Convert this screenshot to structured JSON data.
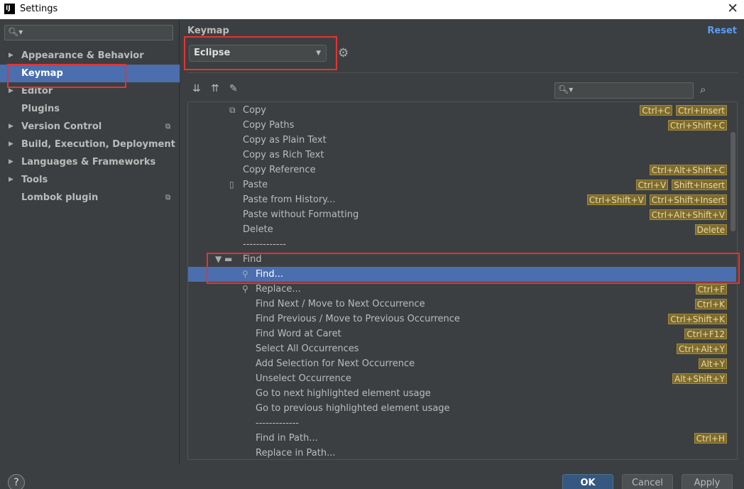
{
  "window": {
    "title": "Settings",
    "logo": "IJ",
    "close_icon": "close-icon"
  },
  "sidebar": {
    "search_placeholder": "",
    "items": [
      {
        "label": "Appearance & Behavior",
        "arrow": "▶",
        "project": ""
      },
      {
        "label": "Keymap",
        "arrow": "",
        "project": ""
      },
      {
        "label": "Editor",
        "arrow": "▶",
        "project": ""
      },
      {
        "label": "Plugins",
        "arrow": "",
        "project": ""
      },
      {
        "label": "Version Control",
        "arrow": "▶",
        "project": "⧉"
      },
      {
        "label": "Build, Execution, Deployment",
        "arrow": "▶",
        "project": ""
      },
      {
        "label": "Languages & Frameworks",
        "arrow": "▶",
        "project": ""
      },
      {
        "label": "Tools",
        "arrow": "▶",
        "project": ""
      },
      {
        "label": "Lombok plugin",
        "arrow": "",
        "project": "⧉"
      }
    ]
  },
  "keymap": {
    "title": "Keymap",
    "reset_label": "Reset",
    "scheme": "Eclipse",
    "tree": [
      {
        "icon": "⧉",
        "label": "Copy",
        "keys": [
          "Ctrl+C",
          "Ctrl+Insert"
        ]
      },
      {
        "icon": "",
        "label": "Copy Paths",
        "keys": [
          "Ctrl+Shift+C"
        ]
      },
      {
        "icon": "",
        "label": "Copy as Plain Text",
        "keys": []
      },
      {
        "icon": "",
        "label": "Copy as Rich Text",
        "keys": []
      },
      {
        "icon": "",
        "label": "Copy Reference",
        "keys": [
          "Ctrl+Alt+Shift+C"
        ]
      },
      {
        "icon": "▯",
        "label": "Paste",
        "keys": [
          "Ctrl+V",
          "Shift+Insert"
        ]
      },
      {
        "icon": "",
        "label": "Paste from History...",
        "keys": [
          "Ctrl+Shift+V",
          "Ctrl+Shift+Insert"
        ]
      },
      {
        "icon": "",
        "label": "Paste without Formatting",
        "keys": [
          "Ctrl+Alt+Shift+V"
        ]
      },
      {
        "icon": "",
        "label": "Delete",
        "keys": [
          "Delete"
        ]
      },
      {
        "icon": "",
        "label": "-------------",
        "keys": []
      },
      {
        "icon": "▼ ▬",
        "label": "Find",
        "keys": []
      },
      {
        "icon": "⚲",
        "label": "Find...",
        "keys": []
      },
      {
        "icon": "⚲",
        "label": "Replace...",
        "keys": [
          "Ctrl+F"
        ]
      },
      {
        "icon": "",
        "label": "Find Next / Move to Next Occurrence",
        "keys": [
          "Ctrl+K"
        ]
      },
      {
        "icon": "",
        "label": "Find Previous / Move to Previous Occurrence",
        "keys": [
          "Ctrl+Shift+K"
        ]
      },
      {
        "icon": "",
        "label": "Find Word at Caret",
        "keys": [
          "Ctrl+F12"
        ]
      },
      {
        "icon": "",
        "label": "Select All Occurrences",
        "keys": [
          "Ctrl+Alt+Y"
        ]
      },
      {
        "icon": "",
        "label": "Add Selection for Next Occurrence",
        "keys": [
          "Alt+Y"
        ]
      },
      {
        "icon": "",
        "label": "Unselect Occurrence",
        "keys": [
          "Alt+Shift+Y"
        ]
      },
      {
        "icon": "",
        "label": "Go to next highlighted element usage",
        "keys": []
      },
      {
        "icon": "",
        "label": "Go to previous highlighted element usage",
        "keys": []
      },
      {
        "icon": "",
        "label": "-------------",
        "keys": []
      },
      {
        "icon": "",
        "label": "Find in Path...",
        "keys": [
          "Ctrl+H"
        ]
      },
      {
        "icon": "",
        "label": "Replace in Path...",
        "keys": []
      }
    ]
  },
  "footer": {
    "help": "?",
    "ok": "OK",
    "cancel": "Cancel",
    "apply": "Apply"
  },
  "colors": {
    "background": "#3c3f41",
    "selection": "#4b6eaf",
    "accent_link": "#589df6",
    "highlight_box": "#e53333",
    "shortcut_bg": "#7f6b2b"
  }
}
